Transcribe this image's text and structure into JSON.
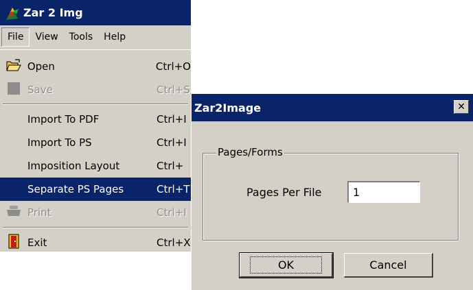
{
  "app": {
    "title": "Zar 2 Img"
  },
  "menubar": {
    "items": [
      "File",
      "View",
      "Tools",
      "Help"
    ]
  },
  "file_menu": {
    "items": [
      {
        "label": "Open",
        "shortcut": "Ctrl+O",
        "icon": "open-folder-icon",
        "state": "normal"
      },
      {
        "label": "Save",
        "shortcut": "Ctrl+S",
        "icon": "save-icon",
        "state": "disabled"
      },
      {
        "label": "Import To PDF",
        "shortcut": "Ctrl+I",
        "icon": "",
        "state": "normal"
      },
      {
        "label": "Import To PS",
        "shortcut": "Ctrl+I",
        "icon": "",
        "state": "normal"
      },
      {
        "label": "Imposition Layout",
        "shortcut": "Ctrl+",
        "icon": "",
        "state": "normal"
      },
      {
        "label": "Separate PS Pages",
        "shortcut": "Ctrl+T",
        "icon": "",
        "state": "highlighted"
      },
      {
        "label": "Print",
        "shortcut": "Ctrl+I",
        "icon": "printer-icon",
        "state": "disabled"
      },
      {
        "label": "Exit",
        "shortcut": "Ctrl+X",
        "icon": "exit-door-icon",
        "state": "normal"
      }
    ]
  },
  "dialog": {
    "title": "Zar2Image",
    "close_glyph": "✕",
    "group_label": "Pages/Forms",
    "pages_per_file_label": "Pages Per File",
    "pages_per_file_value": "1",
    "ok_label": "OK",
    "cancel_label": "Cancel"
  },
  "colors": {
    "titlebar": "#0a246a",
    "face": "#d4d0c8",
    "highlight": "#0a246a",
    "disabled_text": "#8c8c8c"
  }
}
